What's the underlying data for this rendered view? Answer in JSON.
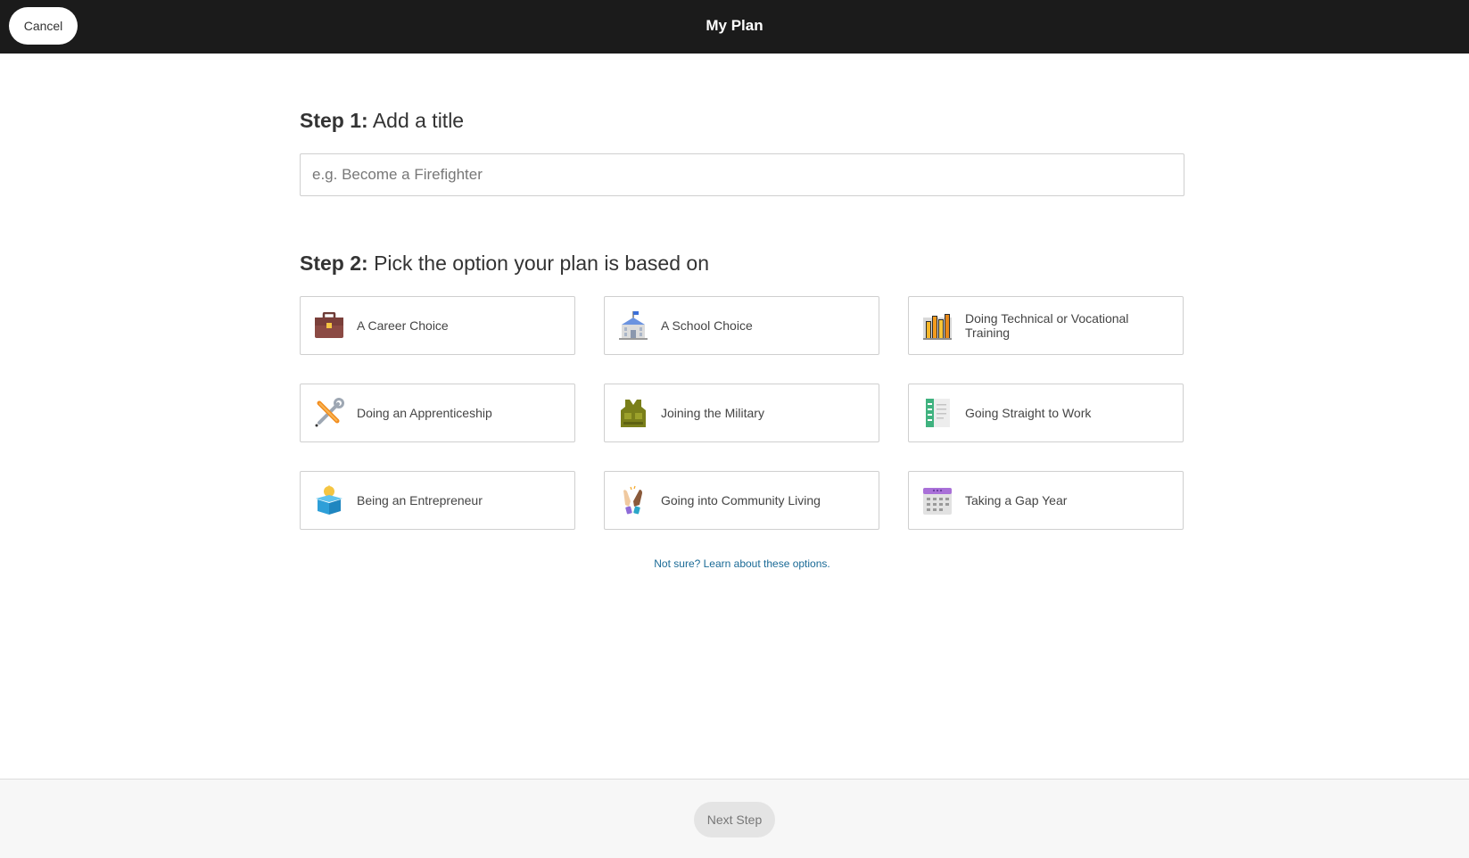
{
  "header": {
    "cancel_label": "Cancel",
    "title": "My Plan"
  },
  "step1": {
    "prefix": "Step 1:",
    "text": "Add a title",
    "input_placeholder": "e.g. Become a Firefighter",
    "input_value": ""
  },
  "step2": {
    "prefix": "Step 2:",
    "text": "Pick the option your plan is based on",
    "options": [
      {
        "label": "A Career Choice",
        "icon": "briefcase-icon"
      },
      {
        "label": "A School Choice",
        "icon": "school-building-icon"
      },
      {
        "label": "Doing Technical or Vocational Training",
        "icon": "books-icon"
      },
      {
        "label": "Doing an Apprenticeship",
        "icon": "tools-icon"
      },
      {
        "label": "Joining the Military",
        "icon": "military-vest-icon"
      },
      {
        "label": "Going Straight to Work",
        "icon": "document-icon"
      },
      {
        "label": "Being an Entrepreneur",
        "icon": "lightbulb-box-icon"
      },
      {
        "label": "Going into Community Living",
        "icon": "high-five-icon"
      },
      {
        "label": "Taking a Gap Year",
        "icon": "calendar-icon"
      }
    ],
    "learn_link": "Not sure? Learn about these options."
  },
  "footer": {
    "next_label": "Next Step"
  },
  "colors": {
    "topbar": "#1b1b1b",
    "link": "#1a6a96",
    "border": "#cfcfcf",
    "footer_bg": "#f7f7f7"
  }
}
